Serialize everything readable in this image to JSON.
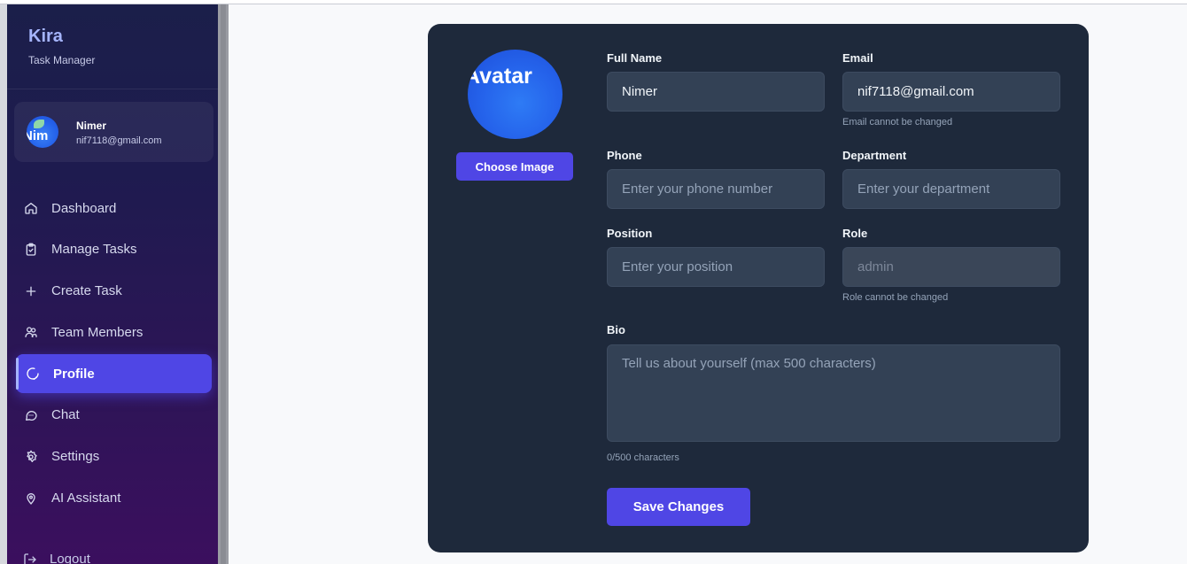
{
  "brand": {
    "name": "Kira",
    "subtitle": "Task Manager"
  },
  "user": {
    "name": "Nimer",
    "email": "nif7118@gmail.com",
    "avatar_text": "Nim"
  },
  "nav": [
    {
      "label": "Dashboard",
      "icon": "home-icon"
    },
    {
      "label": "Manage Tasks",
      "icon": "clipboard-icon"
    },
    {
      "label": "Create Task",
      "icon": "plus-icon"
    },
    {
      "label": "Team Members",
      "icon": "users-icon"
    },
    {
      "label": "Profile",
      "icon": "loader-icon",
      "active": true
    },
    {
      "label": "Chat",
      "icon": "message-icon"
    },
    {
      "label": "Settings",
      "icon": "gear-icon"
    },
    {
      "label": "AI Assistant",
      "icon": "location-pin-icon"
    }
  ],
  "logout_label": "Logout",
  "profile": {
    "avatar_text": "Avatar",
    "choose_image_label": "Choose Image",
    "full_name": {
      "label": "Full Name",
      "value": "Nimer"
    },
    "email": {
      "label": "Email",
      "value": "nif7118@gmail.com",
      "hint": "Email cannot be changed"
    },
    "phone": {
      "label": "Phone",
      "placeholder": "Enter your phone number"
    },
    "department": {
      "label": "Department",
      "placeholder": "Enter your department"
    },
    "position": {
      "label": "Position",
      "placeholder": "Enter your position"
    },
    "role": {
      "label": "Role",
      "value": "admin",
      "hint": "Role cannot be changed"
    },
    "bio": {
      "label": "Bio",
      "placeholder": "Tell us about yourself (max 500 characters)",
      "counter": "0/500 characters"
    },
    "save_label": "Save Changes"
  },
  "colors": {
    "accent": "#4f46e5",
    "card_bg": "#1e293b",
    "input_bg": "#334155"
  }
}
